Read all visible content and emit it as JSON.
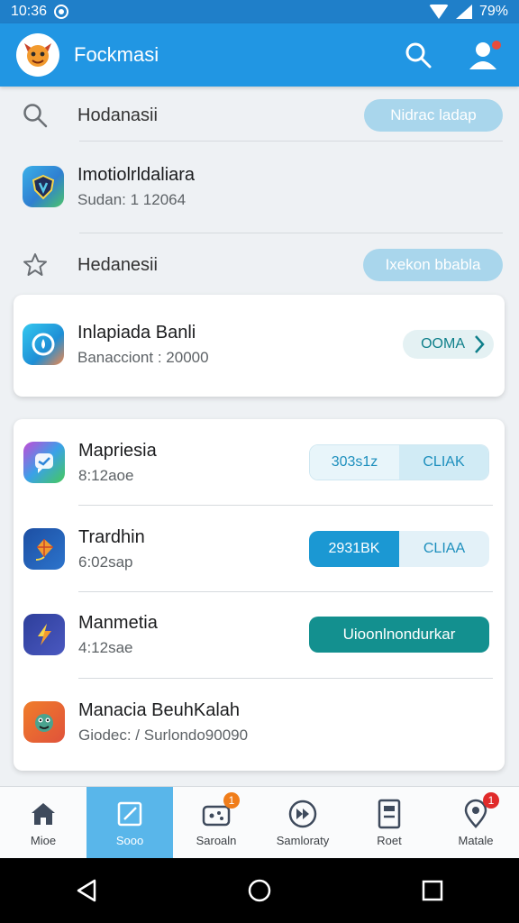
{
  "status_bar": {
    "time": "10:36",
    "battery": "79%"
  },
  "app_bar": {
    "title": "Fockmasi"
  },
  "search_row": {
    "label": "Hodanasii",
    "button": "Nidrac ladap"
  },
  "promo_row": {
    "title": "Imotiolrldaliara",
    "subtitle": "Sudan: 1 12064"
  },
  "favorites_row": {
    "label": "Hedanesii",
    "button": "Ixekon bbabla"
  },
  "featured": {
    "title": "Inlapiada Banli",
    "subtitle": "Banacciont : 20000",
    "button": "OOMA"
  },
  "list": [
    {
      "title": "Mapriesia",
      "subtitle": "8:12aoe",
      "buttons": [
        "303s1z",
        "CLIAK"
      ],
      "icon": "messenger-icon",
      "style": "light"
    },
    {
      "title": "Trardhin",
      "subtitle": "6:02sap",
      "buttons": [
        "2931BK",
        "CLIAA"
      ],
      "icon": "kite-icon",
      "style": "blue"
    },
    {
      "title": "Manmetia",
      "subtitle": "4:12sae",
      "button": "Uioonlnondurkar",
      "icon": "lightning-icon",
      "style": "teal"
    },
    {
      "title": "Manacia BeuhKalah",
      "subtitle": "Giodec: / Surlondo90090",
      "icon": "creature-icon"
    }
  ],
  "bottom_nav": [
    {
      "label": "Mioe",
      "icon": "home-icon"
    },
    {
      "label": "Sooo",
      "icon": "edit-icon",
      "active": true
    },
    {
      "label": "Saroaln",
      "icon": "game-icon",
      "badge": "1"
    },
    {
      "label": "Samloraty",
      "icon": "media-icon"
    },
    {
      "label": "Roet",
      "icon": "document-icon"
    },
    {
      "label": "Matale",
      "icon": "location-icon",
      "badge": "1"
    }
  ],
  "colors": {
    "primary": "#2196e3",
    "teal": "#13908f",
    "badge_orange": "#f07d1a",
    "badge_red": "#e02a2a"
  }
}
